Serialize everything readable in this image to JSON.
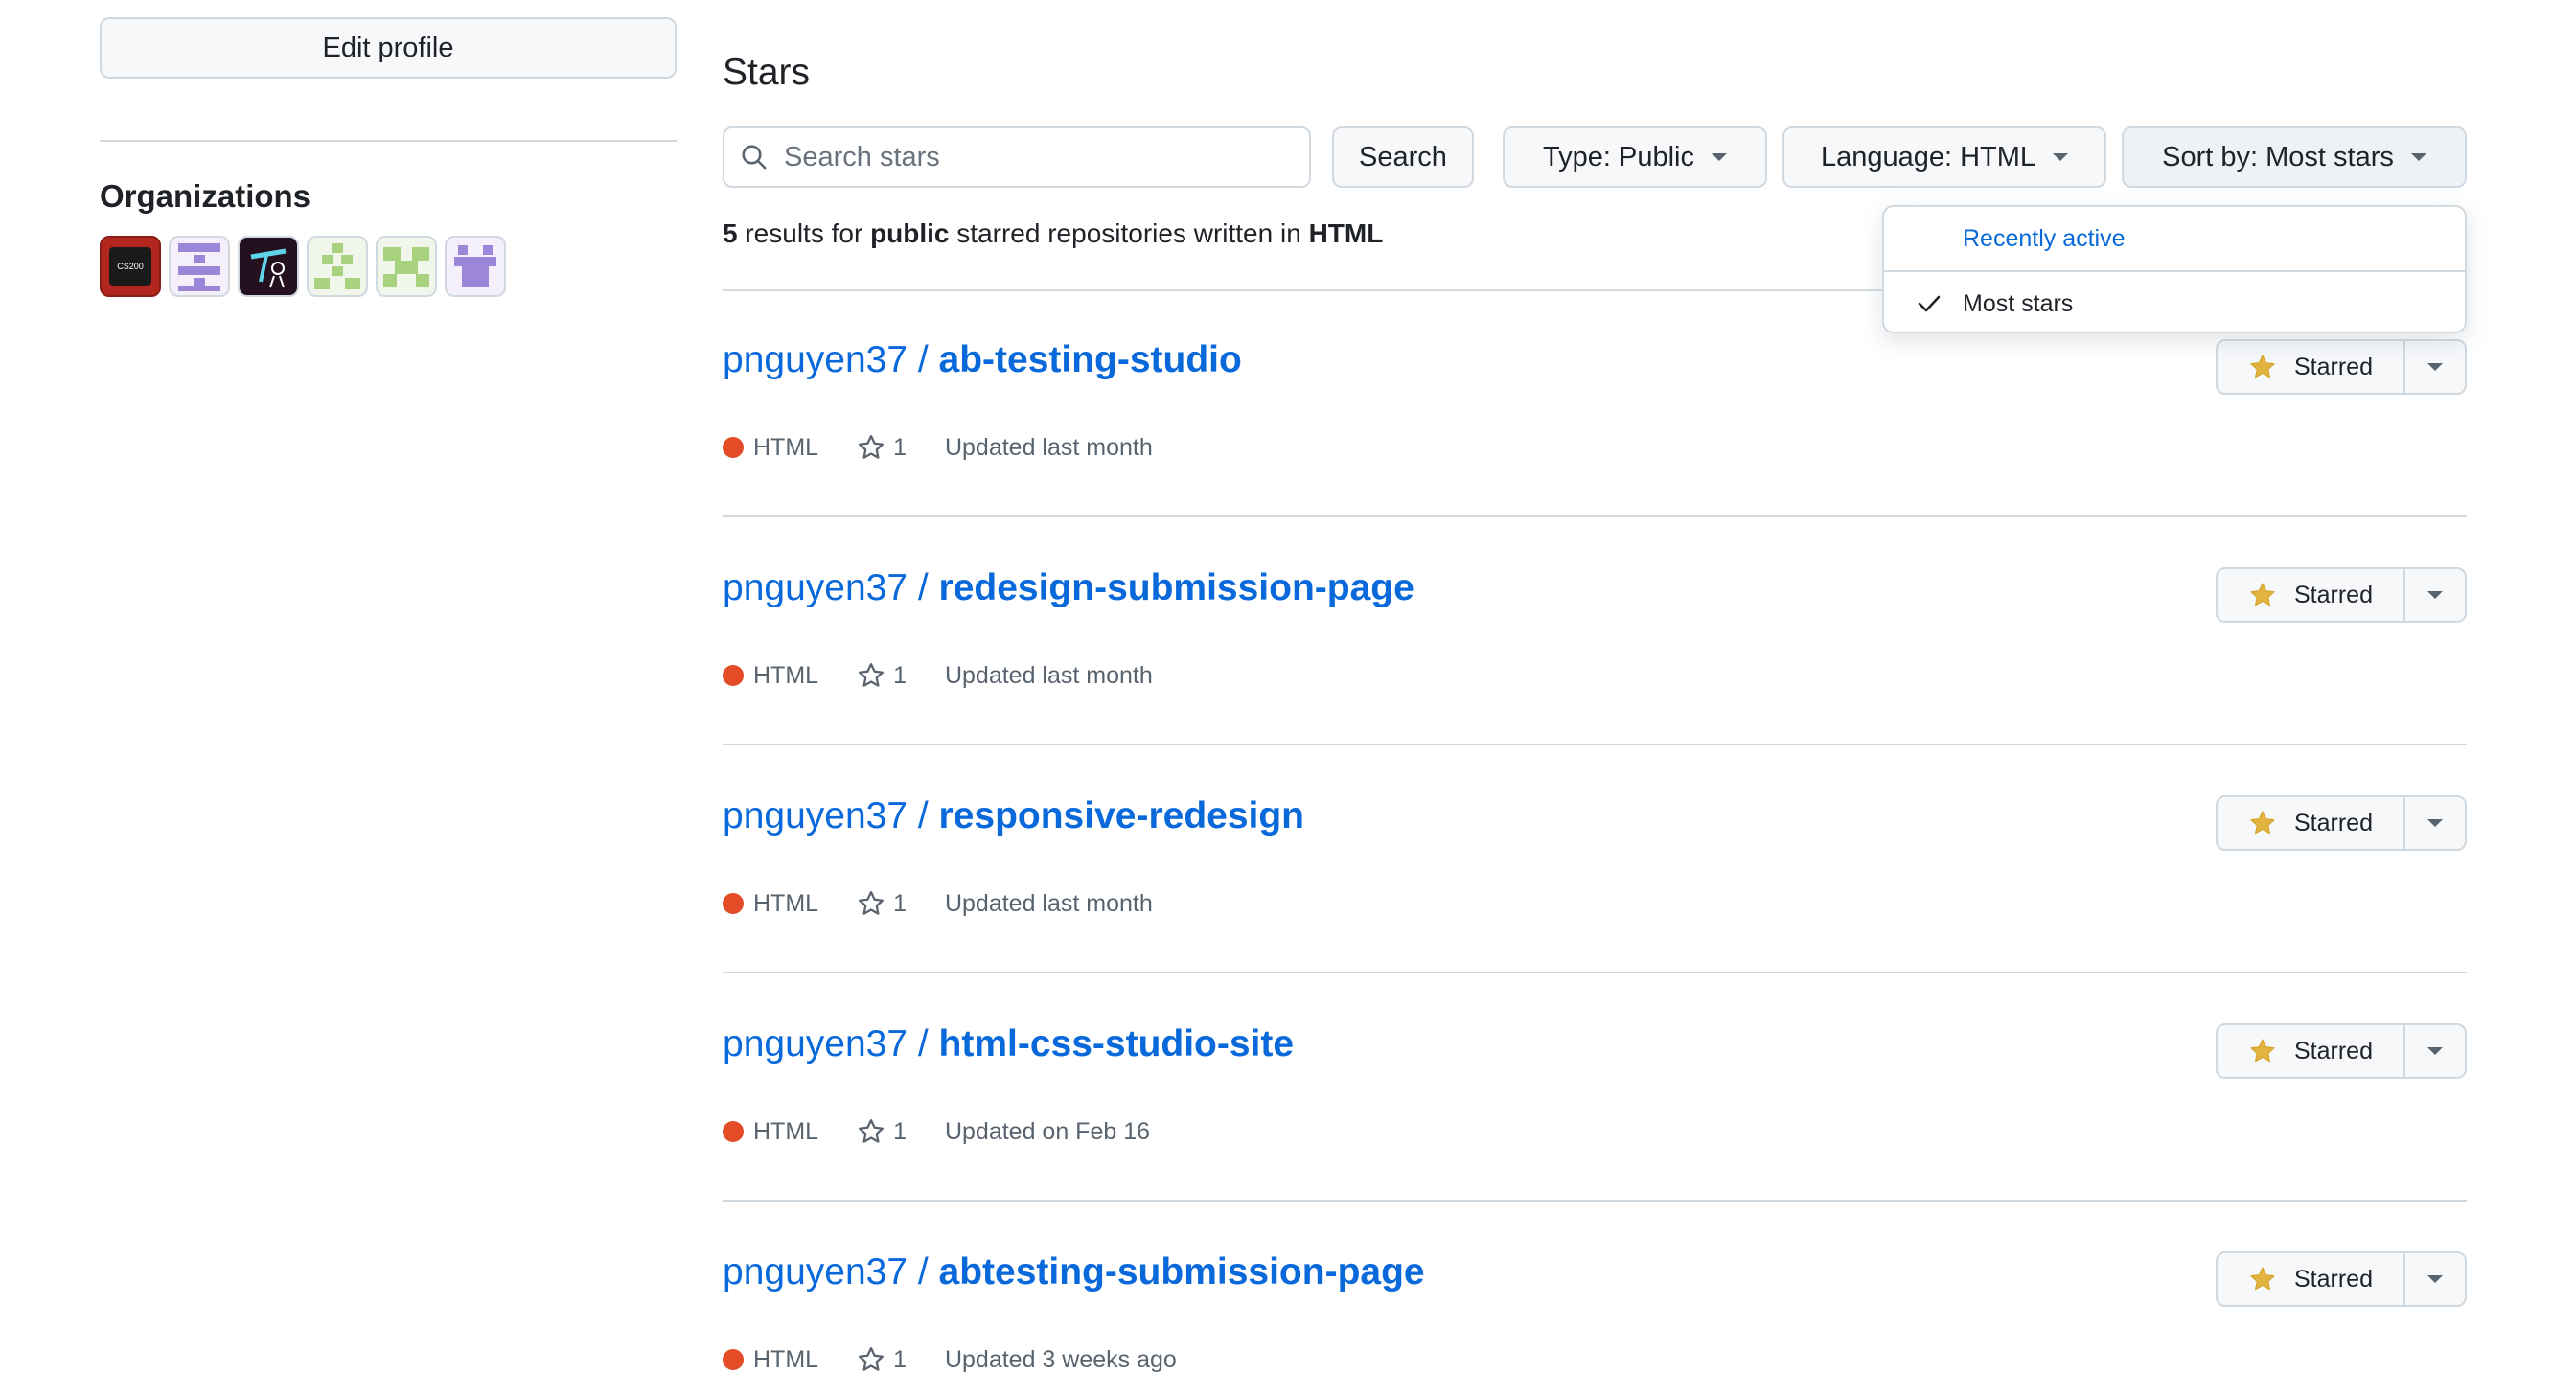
{
  "sidebar": {
    "edit_profile_label": "Edit profile",
    "organizations_title": "Organizations",
    "organizations": [
      {
        "name": "cs200-org-avatar",
        "text": "CS200"
      },
      {
        "name": "purple-org-avatar"
      },
      {
        "name": "dancer-org-avatar"
      },
      {
        "name": "green-pixel-org-avatar"
      },
      {
        "name": "green-block-org-avatar"
      },
      {
        "name": "purple-pixel-org-avatar"
      }
    ]
  },
  "main": {
    "title": "Stars",
    "search_placeholder": "Search stars",
    "search_button": "Search",
    "filters": {
      "type": "Type: Public",
      "language": "Language: HTML",
      "sort": "Sort by: Most stars"
    },
    "results": {
      "count": "5",
      "t1": " results for ",
      "scope": "public",
      "t2": " starred repositories written in ",
      "language": "HTML"
    },
    "sort_menu": {
      "options": [
        "Recently active",
        "Most stars"
      ],
      "selected": "Most stars"
    },
    "repos": [
      {
        "owner": "pnguyen37 / ",
        "name": "ab-testing-studio",
        "language": "HTML",
        "stars": "1",
        "updated": "Updated last month",
        "star_label": "Starred"
      },
      {
        "owner": "pnguyen37 / ",
        "name": "redesign-submission-page",
        "language": "HTML",
        "stars": "1",
        "updated": "Updated last month",
        "star_label": "Starred"
      },
      {
        "owner": "pnguyen37 / ",
        "name": "responsive-redesign",
        "language": "HTML",
        "stars": "1",
        "updated": "Updated last month",
        "star_label": "Starred"
      },
      {
        "owner": "pnguyen37 / ",
        "name": "html-css-studio-site",
        "language": "HTML",
        "stars": "1",
        "updated": "Updated on Feb 16",
        "star_label": "Starred"
      },
      {
        "owner": "pnguyen37 / ",
        "name": "abtesting-submission-page",
        "language": "HTML",
        "stars": "1",
        "updated": "Updated 3 weeks ago",
        "star_label": "Starred"
      }
    ]
  },
  "colors": {
    "link": "#0969da",
    "language_html": "#e34c26",
    "star_fill": "#e3b341",
    "border": "#d1d9e0"
  }
}
